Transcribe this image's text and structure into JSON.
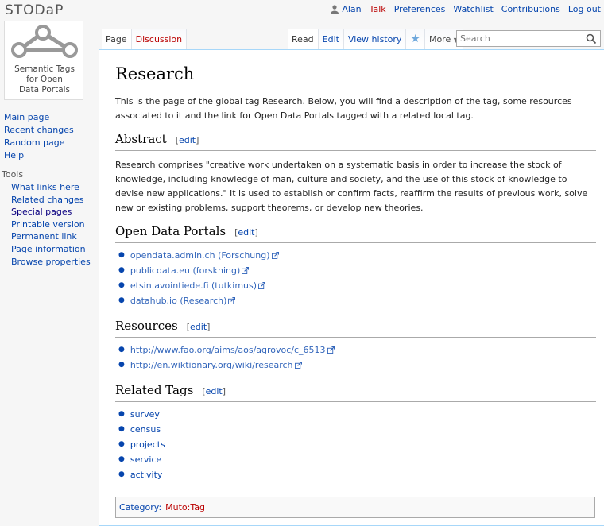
{
  "personal": {
    "user": "Alan",
    "talk": "Talk",
    "preferences": "Preferences",
    "watchlist": "Watchlist",
    "contributions": "Contributions",
    "logout": "Log out"
  },
  "logo": {
    "title": "STODaP",
    "subtitle_lines": [
      "Semantic Tags",
      "for Open",
      "Data Portals"
    ]
  },
  "sidebar": {
    "nav": [
      "Main page",
      "Recent changes",
      "Random page",
      "Help"
    ],
    "tools_heading": "Tools",
    "tools": [
      "What links here",
      "Related changes",
      "Special pages",
      "Printable version",
      "Permanent link",
      "Page information",
      "Browse properties"
    ]
  },
  "tabs": {
    "page": "Page",
    "discussion": "Discussion",
    "read": "Read",
    "edit": "Edit",
    "history": "View history",
    "more": "More"
  },
  "search": {
    "placeholder": "Search",
    "value": "Search"
  },
  "content": {
    "title": "Research",
    "intro": "This is the page of the global tag Research. Below, you will find a description of the tag, some resources associated to it and the link for Open Data Portals tagged with a related local tag.",
    "edit_label": "edit",
    "abstract_heading": "Abstract",
    "abstract_text": "Research comprises \"creative work undertaken on a systematic basis in order to increase the stock of knowledge, including knowledge of man, culture and society, and the use of this stock of knowledge to devise new applications.\" It is used to establish or confirm facts, reaffirm the results of previous work, solve new or existing problems, support theorems, or develop new theories.",
    "portals_heading": "Open Data Portals",
    "portals": [
      "opendata.admin.ch (Forschung)",
      "publicdata.eu (forskning)",
      "etsin.avointiede.fi (tutkimus)",
      "datahub.io (Research)"
    ],
    "resources_heading": "Resources",
    "resources": [
      "http://www.fao.org/aims/aos/agrovoc/c_6513",
      "http://en.wiktionary.org/wiki/research"
    ],
    "related_heading": "Related Tags",
    "related": [
      "survey",
      "census",
      "projects",
      "service",
      "activity"
    ],
    "category_label": "Category:",
    "category_value": "Muto:Tag"
  }
}
